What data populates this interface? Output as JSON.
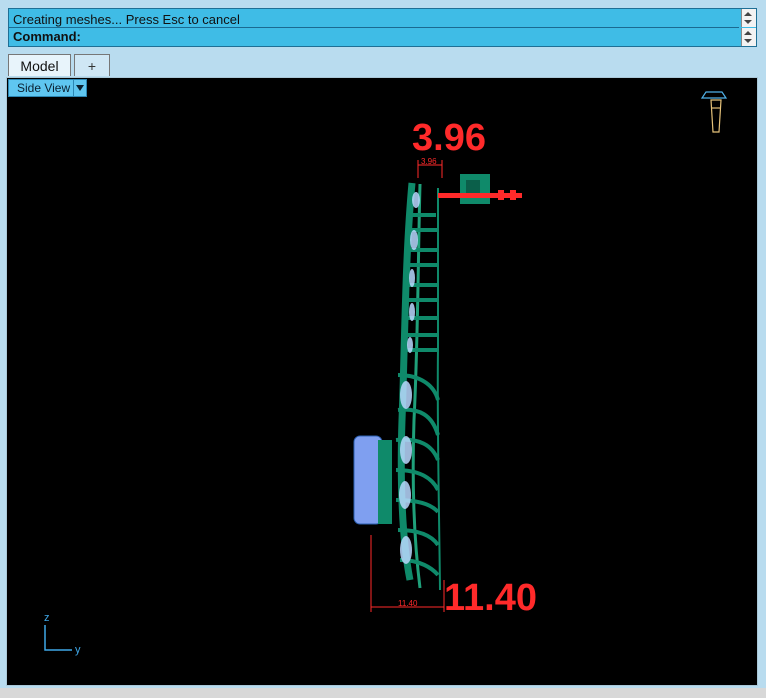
{
  "command": {
    "line1": "Creating meshes... Press Esc to cancel",
    "line2": "Command:"
  },
  "tabs": {
    "model": "Model",
    "add": "+"
  },
  "viewport": {
    "name": "Side View",
    "dimension_top": "3.96",
    "dimension_top_small": "3.96",
    "dimension_bottom": "11.40",
    "dimension_bottom_small": "11.40",
    "axis_z": "z",
    "axis_y": "y"
  },
  "colors": {
    "dimension_red": "#ff2a2a",
    "model_green": "#0f8a6a",
    "highlight_blue": "#b9d9ff"
  }
}
